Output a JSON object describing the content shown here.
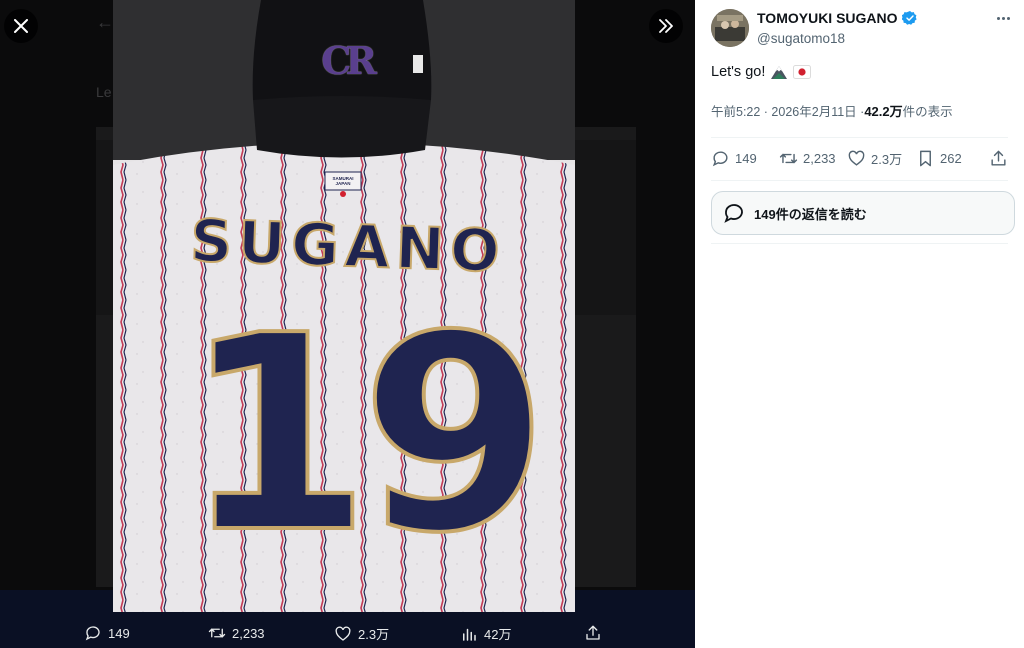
{
  "tweet": {
    "author_name": "TOMOYUKI SUGANO",
    "handle": "@sugatomo18",
    "text": "Let's go!",
    "emojis": [
      "mountain-emoji",
      "japan-flag-emoji"
    ],
    "time": "午前5:22 · 2026年2月11日 · ",
    "views_count": "42.2万",
    "views_label": " 件の表示",
    "verified": true
  },
  "actions": {
    "replies": "149",
    "retweets": "2,233",
    "likes": "2.3万",
    "bookmarks": "262"
  },
  "replies_button": {
    "label": "149件の返信を読む"
  },
  "viewer_bar": {
    "replies": "149",
    "retweets": "2,233",
    "likes": "2.3万",
    "views": "42万"
  },
  "photo": {
    "cap_logo": "CR",
    "patch_text": "SAMURAI JAPAN",
    "jersey_name": "SUGANO",
    "jersey_number": "19"
  },
  "colors": {
    "accent": "#1d9bf0",
    "navy": "#1f2450",
    "gold": "#c8a86a",
    "pinstripe": "#c23a55"
  }
}
